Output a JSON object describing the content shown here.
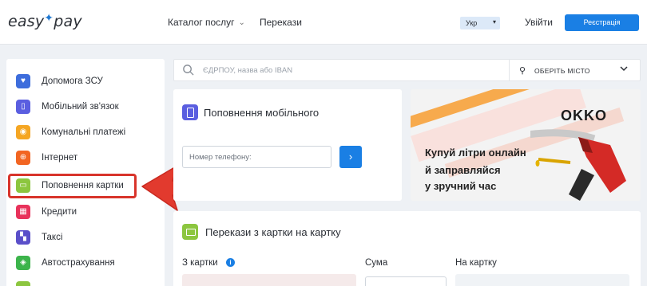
{
  "header": {
    "logo_text": "easy",
    "logo_text2": "pay",
    "nav": {
      "catalog": "Каталог послуг",
      "transfers": "Перекази"
    },
    "lang": "Укр",
    "login": "Увійти",
    "register": "Реєстрація"
  },
  "sidebar": {
    "items": [
      {
        "label": "Допомога ЗСУ",
        "icon": "heart-hands-icon",
        "color": "#3d6ddc"
      },
      {
        "label": "Мобільний зв'язок",
        "icon": "phone-icon",
        "color": "#5a5ee0"
      },
      {
        "label": "Комунальні платежі",
        "icon": "bulb-icon",
        "color": "#f5a623"
      },
      {
        "label": "Інтернет",
        "icon": "globe-icon",
        "color": "#f26522"
      },
      {
        "label": "Поповнення картки",
        "icon": "card-icon",
        "color": "#8cc63f"
      },
      {
        "label": "Кредити",
        "icon": "bank-icon",
        "color": "#e8325b"
      },
      {
        "label": "Таксі",
        "icon": "taxi-icon",
        "color": "#5a4fc9"
      },
      {
        "label": "Автострахування",
        "icon": "shield-car-icon",
        "color": "#3cb44b"
      }
    ]
  },
  "search": {
    "placeholder": "ЄДРПОУ, назва або IBAN",
    "city": "ОБЕРІТЬ МІСТО"
  },
  "mobile_card": {
    "title": "Поповнення мобільного",
    "phone_placeholder": "Номер телефону:",
    "go": "›"
  },
  "promo": {
    "brand": "OKKO",
    "line1": "Купуй літри онлайн",
    "line2": "й заправляйся",
    "line3": "у зручний час"
  },
  "transfer_card": {
    "title": "Перекази з картки на картку",
    "from": "З картки",
    "info": "i",
    "sum": "Сума",
    "to": "На картку"
  },
  "colors": {
    "accent": "#1a7fe4",
    "highlight": "#d8342b"
  }
}
